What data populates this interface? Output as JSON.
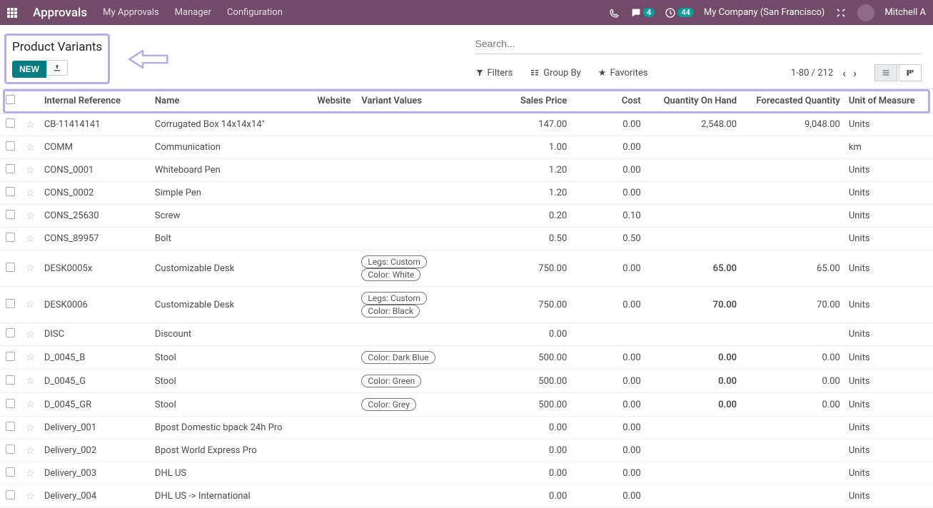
{
  "nav": {
    "brand": "Approvals",
    "menu": [
      "My Approvals",
      "Manager",
      "Configuration"
    ],
    "msg_count": "4",
    "clock_count": "44",
    "company": "My Company (San Francisco)",
    "user": "Mitchell A"
  },
  "cp": {
    "title": "Product Variants",
    "new_btn": "NEW",
    "search_placeholder": "Search...",
    "filters": "Filters",
    "groupby": "Group By",
    "favorites": "Favorites",
    "pager": "1-80 / 212"
  },
  "cols": {
    "ref": "Internal Reference",
    "name": "Name",
    "website": "Website",
    "variants": "Variant Values",
    "price": "Sales Price",
    "cost": "Cost",
    "qty": "Quantity On Hand",
    "forecast": "Forecasted Quantity",
    "uom": "Unit of Measure"
  },
  "rows": [
    {
      "ref": "CB-11414141",
      "name": "Corrugated Box 14x14x14\"",
      "variants": [],
      "price": "147.00",
      "cost": "0.00",
      "qty": "2,548.00",
      "forecast": "9,048.00",
      "uom": "Units"
    },
    {
      "ref": "COMM",
      "name": "Communication",
      "variants": [],
      "price": "1.00",
      "cost": "0.00",
      "qty": "",
      "forecast": "",
      "uom": "km"
    },
    {
      "ref": "CONS_0001",
      "name": "Whiteboard Pen",
      "variants": [],
      "price": "1.20",
      "cost": "0.00",
      "qty": "",
      "forecast": "",
      "uom": "Units"
    },
    {
      "ref": "CONS_0002",
      "name": "Simple Pen",
      "variants": [],
      "price": "1.20",
      "cost": "0.00",
      "qty": "",
      "forecast": "",
      "uom": "Units"
    },
    {
      "ref": "CONS_25630",
      "name": "Screw",
      "variants": [],
      "price": "0.20",
      "cost": "0.10",
      "qty": "",
      "forecast": "",
      "uom": "Units"
    },
    {
      "ref": "CONS_89957",
      "name": "Bolt",
      "variants": [],
      "price": "0.50",
      "cost": "0.50",
      "qty": "",
      "forecast": "",
      "uom": "Units"
    },
    {
      "ref": "DESK0005x",
      "name": "Customizable Desk",
      "variants": [
        "Legs: Custom",
        "Color: White"
      ],
      "price": "750.00",
      "cost": "0.00",
      "qty": "65.00",
      "qtybold": true,
      "forecast": "65.00",
      "uom": "Units"
    },
    {
      "ref": "DESK0006",
      "name": "Customizable Desk",
      "variants": [
        "Legs: Custom",
        "Color: Black"
      ],
      "price": "750.00",
      "cost": "0.00",
      "qty": "70.00",
      "qtybold": true,
      "forecast": "70.00",
      "uom": "Units"
    },
    {
      "ref": "DISC",
      "name": "Discount",
      "variants": [],
      "price": "0.00",
      "cost": "",
      "qty": "",
      "forecast": "",
      "uom": "Units"
    },
    {
      "ref": "D_0045_B",
      "name": "Stool",
      "variants": [
        "Color: Dark Blue"
      ],
      "price": "500.00",
      "cost": "0.00",
      "qty": "0.00",
      "qtybold": true,
      "forecast": "0.00",
      "uom": "Units"
    },
    {
      "ref": "D_0045_G",
      "name": "Stool",
      "variants": [
        "Color: Green"
      ],
      "price": "500.00",
      "cost": "0.00",
      "qty": "0.00",
      "qtybold": true,
      "forecast": "0.00",
      "uom": "Units"
    },
    {
      "ref": "D_0045_GR",
      "name": "Stool",
      "variants": [
        "Color: Grey"
      ],
      "price": "500.00",
      "cost": "0.00",
      "qty": "0.00",
      "qtybold": true,
      "forecast": "0.00",
      "uom": "Units"
    },
    {
      "ref": "Delivery_001",
      "name": "Bpost Domestic bpack 24h Pro",
      "variants": [],
      "price": "0.00",
      "cost": "0.00",
      "qty": "",
      "forecast": "",
      "uom": "Units"
    },
    {
      "ref": "Delivery_002",
      "name": "Bpost World Express Pro",
      "variants": [],
      "price": "0.00",
      "cost": "0.00",
      "qty": "",
      "forecast": "",
      "uom": "Units"
    },
    {
      "ref": "Delivery_003",
      "name": "DHL US",
      "variants": [],
      "price": "0.00",
      "cost": "0.00",
      "qty": "",
      "forecast": "",
      "uom": "Units"
    },
    {
      "ref": "Delivery_004",
      "name": "DHL US -> International",
      "variants": [],
      "price": "0.00",
      "cost": "0.00",
      "qty": "",
      "forecast": "",
      "uom": "Units"
    }
  ]
}
